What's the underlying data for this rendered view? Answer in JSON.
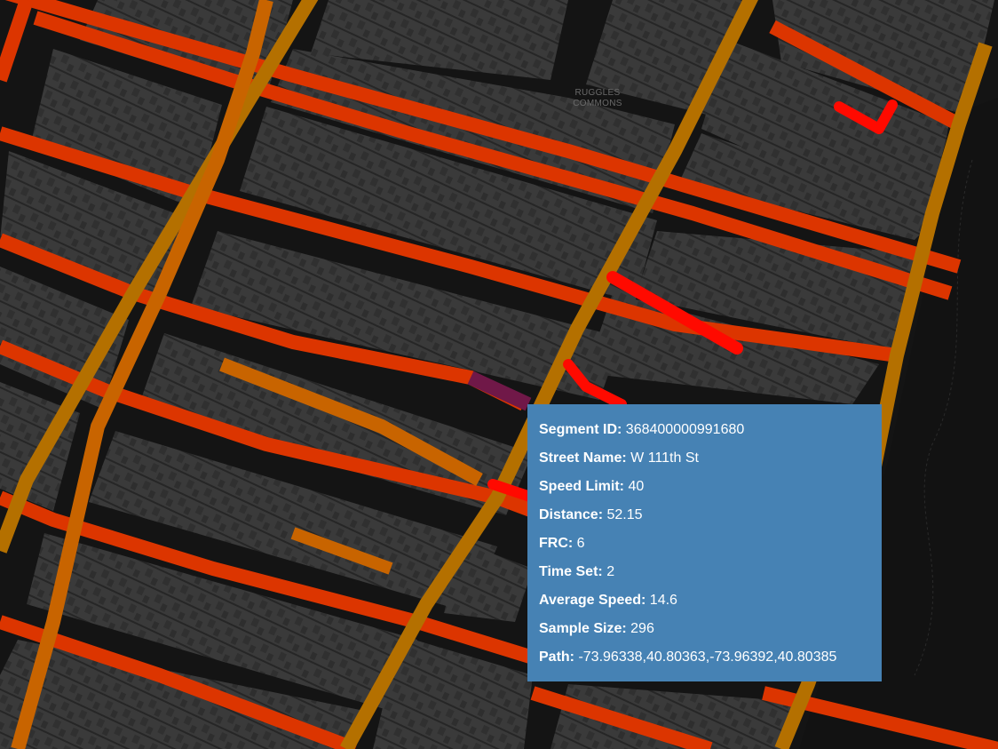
{
  "map": {
    "place_label_line1": "RUGGLES",
    "place_label_line2": "COMMONS",
    "colors": {
      "background": "#141414",
      "block": "#3a3a3a",
      "building": "#2f2f2f",
      "park": "#121212",
      "speed_slow": "#ff0a00",
      "speed_mid": "#dc3500",
      "speed_fast": "#c86400",
      "speed_avenue": "#b47000",
      "selected_segment": "#701848"
    }
  },
  "tooltip": {
    "rows": [
      {
        "label": "Segment ID:",
        "value": "368400000991680"
      },
      {
        "label": "Street Name:",
        "value": "W 111th St"
      },
      {
        "label": "Speed Limit:",
        "value": "40"
      },
      {
        "label": "Distance:",
        "value": "52.15"
      },
      {
        "label": "FRC:",
        "value": "6"
      },
      {
        "label": "Time Set:",
        "value": "2"
      },
      {
        "label": "Average Speed:",
        "value": "14.6"
      },
      {
        "label": "Sample Size:",
        "value": "296"
      },
      {
        "label": "Path:",
        "value": "-73.96338,40.80363,-73.96392,40.80385"
      }
    ],
    "background": "#4682b4"
  }
}
